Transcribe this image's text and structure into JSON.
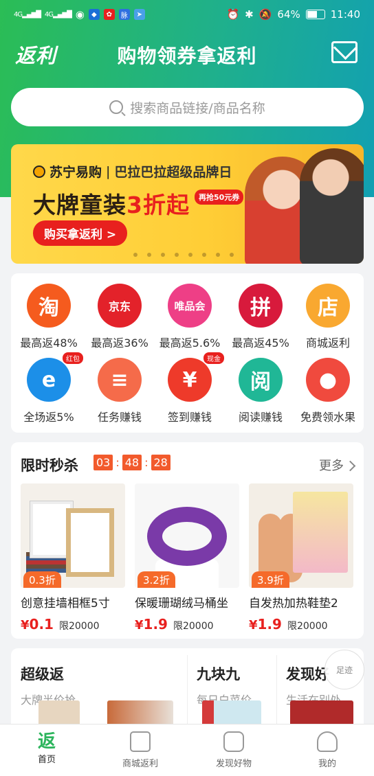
{
  "status": {
    "battery": "64%",
    "time": "11:40",
    "battery_fraction": 0.64,
    "net_left": "4G",
    "net_right": "4G",
    "app_icon_b": "脉"
  },
  "header": {
    "logo": "返利",
    "title": "购物领券拿返利"
  },
  "search": {
    "placeholder": "搜索商品链接/商品名称"
  },
  "banner": {
    "brand": "苏宁易购",
    "brand_sub": "巴拉巴拉超级品牌日",
    "main_prefix": "大牌童装",
    "main_highlight": "3折起",
    "coupon": "再抢50元券",
    "button": "购买拿返利 >",
    "slide_count": 8
  },
  "grid": [
    {
      "label": "最高返48%",
      "icon_text": "淘",
      "color": "#f55b1e",
      "icon": "taobao-icon"
    },
    {
      "label": "最高返36%",
      "icon_text": "京东",
      "color": "#e3222a",
      "icon": "jd-icon"
    },
    {
      "label": "最高返5.6%",
      "icon_text": "唯品会",
      "color": "#ee3f86",
      "icon": "vip-icon"
    },
    {
      "label": "最高返45%",
      "icon_text": "拼",
      "color": "#d81a3c",
      "icon": "pinduoduo-icon"
    },
    {
      "label": "商城返利",
      "icon_text": "店",
      "color": "#f9a830",
      "icon": "store-icon"
    },
    {
      "label": "全场返5%",
      "icon_text": "e",
      "color": "#1c8fe8",
      "icon": "ele-icon",
      "badge": "红包"
    },
    {
      "label": "任务赚钱",
      "icon_text": "≡",
      "color": "#f56b4a",
      "icon": "task-icon"
    },
    {
      "label": "签到赚钱",
      "icon_text": "¥",
      "color": "#ee3a2a",
      "icon": "checkin-icon",
      "badge": "现金"
    },
    {
      "label": "阅读赚钱",
      "icon_text": "阅",
      "color": "#20b796",
      "icon": "read-icon"
    },
    {
      "label": "免费领水果",
      "icon_text": "●",
      "color": "#f04a3e",
      "icon": "apple-icon"
    }
  ],
  "flash": {
    "title": "限时秒杀",
    "timer": {
      "h": "03",
      "m": "48",
      "s": "28"
    },
    "more": "更多",
    "products": [
      {
        "name": "创意挂墙相框5寸",
        "discount": "0.3折",
        "currency": "¥",
        "price": "0.1",
        "limit": "限20000"
      },
      {
        "name": "保暖珊瑚绒马桶坐",
        "discount": "3.2折",
        "currency": "¥",
        "price": "1.9",
        "limit": "限20000"
      },
      {
        "name": "自发热加热鞋垫2",
        "discount": "3.9折",
        "currency": "¥",
        "price": "1.9",
        "limit": "限20000"
      }
    ]
  },
  "categories": [
    {
      "title": "超级返",
      "sub": "大牌半价抢"
    },
    {
      "title": "九块九",
      "sub": "每日白菜价"
    },
    {
      "title": "发现好",
      "sub": "生活在别处"
    }
  ],
  "footprint": {
    "label": "足迹"
  },
  "tabs": [
    {
      "label": "首页",
      "active": true
    },
    {
      "label": "商城返利"
    },
    {
      "label": "发现好物"
    },
    {
      "label": "我的"
    }
  ]
}
